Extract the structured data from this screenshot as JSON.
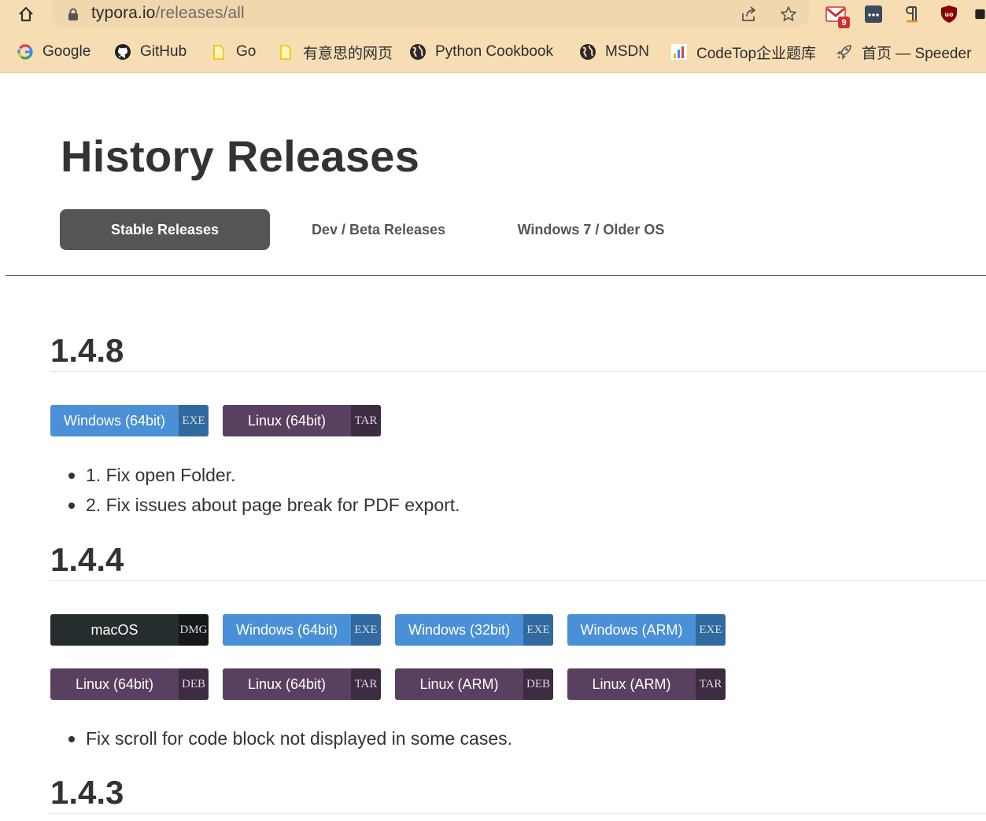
{
  "browser": {
    "url_host": "typora.io",
    "url_path": "/releases/all",
    "gmail_badge": "9",
    "bookmarks": [
      {
        "label": "Google",
        "icon": "google-icon"
      },
      {
        "label": "GitHub",
        "icon": "github-icon"
      },
      {
        "label": "Go",
        "icon": "folder-icon"
      },
      {
        "label": "有意思的网页",
        "icon": "folder-icon"
      },
      {
        "label": "Python Cookbook",
        "icon": "globe-icon"
      },
      {
        "label": "MSDN",
        "icon": "globe-icon"
      },
      {
        "label": "CodeTop企业题库",
        "icon": "bar-chart-icon"
      },
      {
        "label": "首页 — Speeder",
        "icon": "rocket-icon"
      }
    ]
  },
  "page": {
    "title": "History Releases",
    "tabs": [
      {
        "label": "Stable Releases",
        "active": true
      },
      {
        "label": "Dev / Beta Releases",
        "active": false
      },
      {
        "label": "Windows 7 / Older OS",
        "active": false
      }
    ]
  },
  "releases": [
    {
      "version": "1.4.8",
      "downloads": [
        {
          "label": "Windows (64bit)",
          "format": "EXE",
          "platform": "windows"
        },
        {
          "label": "Linux (64bit)",
          "format": "TAR",
          "platform": "linux"
        }
      ],
      "notes": [
        "1. Fix open Folder.",
        "2. Fix issues about page break for PDF export."
      ]
    },
    {
      "version": "1.4.4",
      "downloads": [
        {
          "label": "macOS",
          "format": "DMG",
          "platform": "mac"
        },
        {
          "label": "Windows (64bit)",
          "format": "EXE",
          "platform": "windows"
        },
        {
          "label": "Windows (32bit)",
          "format": "EXE",
          "platform": "windows"
        },
        {
          "label": "Windows (ARM)",
          "format": "EXE",
          "platform": "windows"
        },
        {
          "label": "Linux (64bit)",
          "format": "DEB",
          "platform": "linux"
        },
        {
          "label": "Linux (64bit)",
          "format": "TAR",
          "platform": "linux"
        },
        {
          "label": "Linux (ARM)",
          "format": "DEB",
          "platform": "linux"
        },
        {
          "label": "Linux (ARM)",
          "format": "TAR",
          "platform": "linux"
        }
      ],
      "notes": [
        "Fix scroll for code block not displayed in some cases."
      ]
    },
    {
      "version": "1.4.3",
      "downloads": [],
      "notes": []
    }
  ],
  "colors": {
    "chrome_bg": "#f6ddb4",
    "windows_btn": "#4a90d6",
    "linux_btn": "#5a4060",
    "mac_btn": "#262d2e",
    "active_tab": "#555555"
  }
}
